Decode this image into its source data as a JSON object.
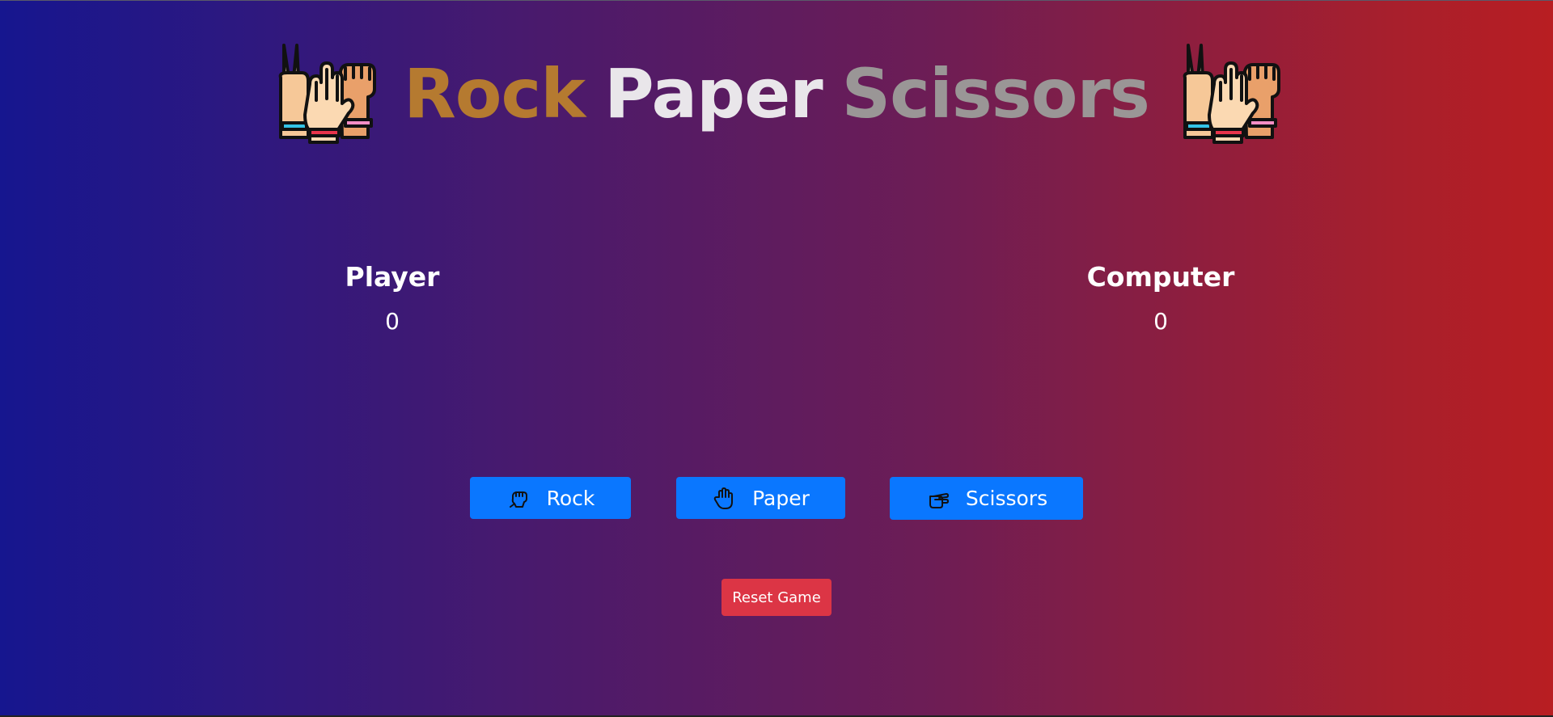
{
  "title": {
    "word_rock": "Rock",
    "word_paper": "Paper",
    "word_scissors": "Scissors",
    "icon": "rock-paper-scissors-hands-icon"
  },
  "scores": {
    "player_label": "Player",
    "player_value": "0",
    "computer_label": "Computer",
    "computer_value": "0"
  },
  "choices": {
    "rock_label": "Rock",
    "rock_icon": "rock-fist-icon",
    "paper_label": "Paper",
    "paper_icon": "paper-hand-icon",
    "scissors_label": "Scissors",
    "scissors_icon": "scissors-hand-icon"
  },
  "reset": {
    "label": "Reset Game"
  },
  "colors": {
    "rock": "#b57a30",
    "paper": "#e9e6ea",
    "scissors": "#9a9696",
    "choice_button": "#0a77ff",
    "reset_button": "#dc3545",
    "gradient_left": "#16168f",
    "gradient_right": "#b81e22"
  }
}
